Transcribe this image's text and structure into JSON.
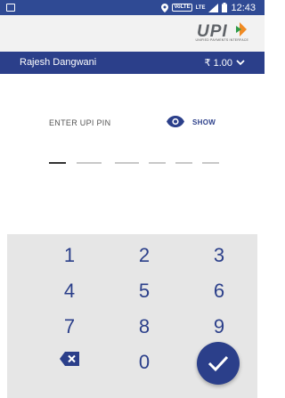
{
  "status_bar": {
    "time": "12:43",
    "network_badge": "VoLTE",
    "network_type": "LTE",
    "icons": [
      "gallery-icon",
      "location-icon",
      "signal-icon",
      "battery-icon"
    ]
  },
  "header": {
    "logo_text": "UPI",
    "logo_tagline": "UNIFIED PAYMENTS INTERFACE"
  },
  "account": {
    "name": "Rajesh Dangwani",
    "amount": "₹ 1.00",
    "expand_icon": "chevron-down-icon"
  },
  "pin": {
    "label": "ENTER UPI PIN",
    "show_label": "SHOW",
    "digits_entered": 0,
    "digit_count": 6
  },
  "keypad": {
    "keys": [
      "1",
      "2",
      "3",
      "4",
      "5",
      "6",
      "7",
      "8",
      "9",
      "0"
    ],
    "backspace_icon": "backspace-icon",
    "submit_icon": "check-icon"
  },
  "colors": {
    "status_bar": "#2f4a94",
    "primary": "#2b3f8a",
    "header_bg": "#f2f2f2",
    "keypad_bg": "#e6e6e6"
  }
}
